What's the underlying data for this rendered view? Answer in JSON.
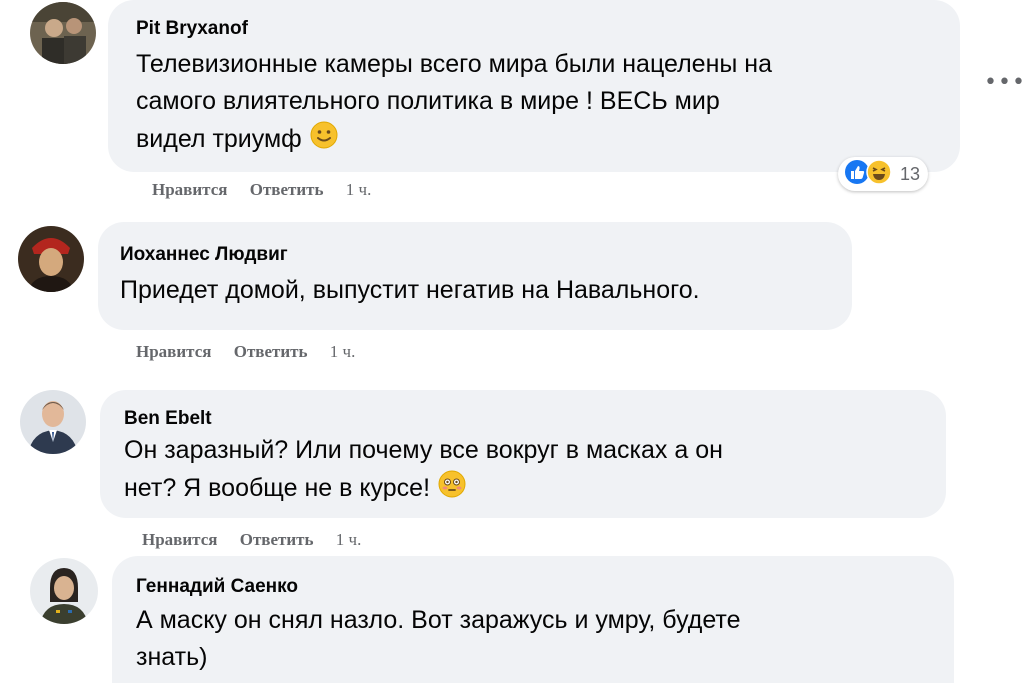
{
  "comments": [
    {
      "author": "Pit Bryxanof",
      "text_lines": [
        "Телевизионные камеры всего мира были нацелены на",
        "самого влиятельного политика в мире ! ВЕСЬ мир",
        "видел триумф"
      ],
      "emoji": "slightly-smiling-face",
      "actions": {
        "like": "Нравится",
        "reply": "Ответить",
        "time": "1 ч."
      },
      "reactions": {
        "icons": [
          "like-icon",
          "haha-icon"
        ],
        "count": "13"
      }
    },
    {
      "author": "Иоханнес Людвиг",
      "text_lines": [
        "Приедет домой, выпустит негатив на Навального."
      ],
      "actions": {
        "like": "Нравится",
        "reply": "Ответить",
        "time": "1 ч."
      }
    },
    {
      "author": "Ben Ebelt",
      "text_lines": [
        "Он заразный? Или почему все вокруг в масках а он",
        "нет? Я вообще не в курсе!"
      ],
      "emoji": "flushed-face",
      "actions": {
        "like": "Нравится",
        "reply": "Ответить",
        "time": "1 ч."
      }
    },
    {
      "author": "Геннадий Саенко",
      "text_lines": [
        "А маску он снял назло. Вот заражусь и умру, будете",
        "знать)"
      ]
    }
  ],
  "more_icon": "more-options-icon",
  "colors": {
    "bubble": "#f0f2f5",
    "secondary_text": "#65676b",
    "like_blue": "#1877f2",
    "emoji_yellow": "#f7c12c"
  }
}
